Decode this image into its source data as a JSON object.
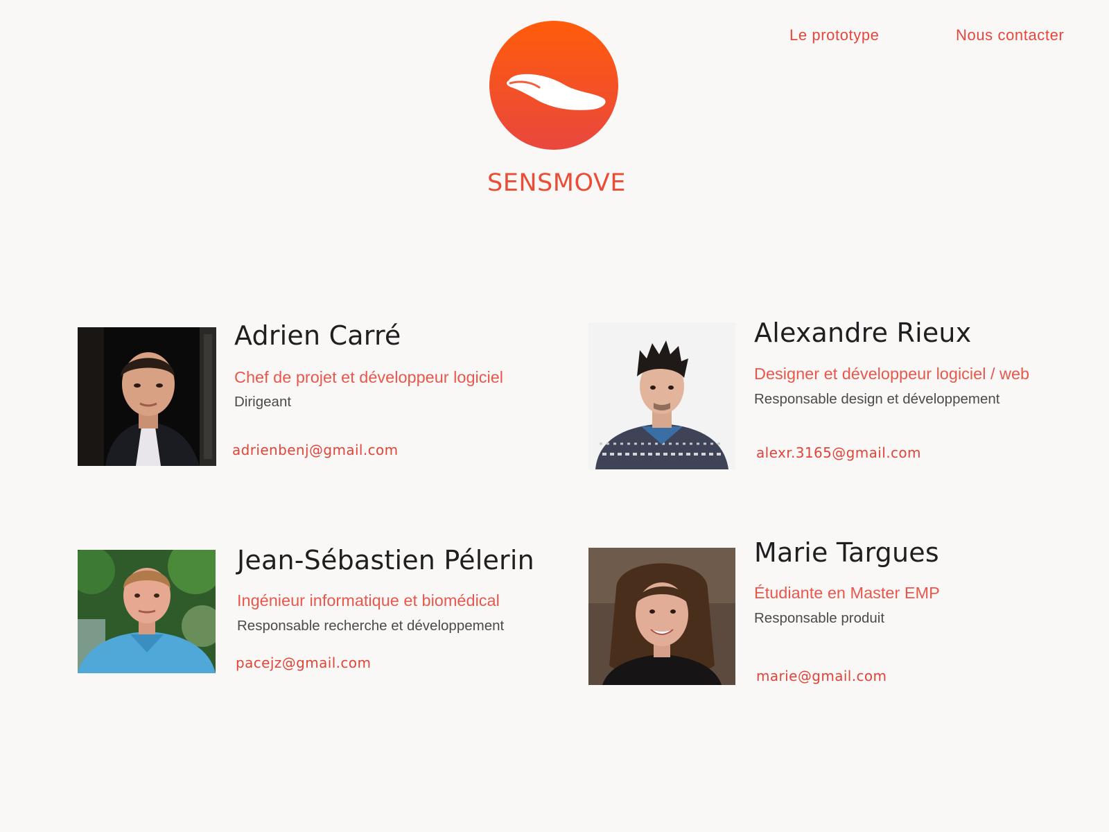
{
  "nav": {
    "prototype_label": "Le prototype",
    "contact_label": "Nous contacter"
  },
  "brand": {
    "name": "SENSMOVE",
    "logo_icon": "insole-icon",
    "accent_color": "#e8453c",
    "gradient_top": "#ff5c0b",
    "gradient_bottom": "#e9473e"
  },
  "team": [
    {
      "name": "Adrien Carré",
      "role": "Chef de projet et développeur logiciel",
      "duty": "Dirigeant",
      "email": "adrienbenj@gmail.com"
    },
    {
      "name": "Alexandre Rieux",
      "role": "Designer et développeur logiciel / web",
      "duty": "Responsable design et développement",
      "email": "alexr.3165@gmail.com"
    },
    {
      "name": "Jean-Sébastien Pélerin",
      "role": "Ingénieur informatique et biomédical",
      "duty": "Responsable recherche et développement",
      "email": "pacejz@gmail.com"
    },
    {
      "name": "Marie Targues",
      "role": "Étudiante en Master EMP",
      "duty": "Responsable produit",
      "email": "marie@gmail.com"
    }
  ]
}
